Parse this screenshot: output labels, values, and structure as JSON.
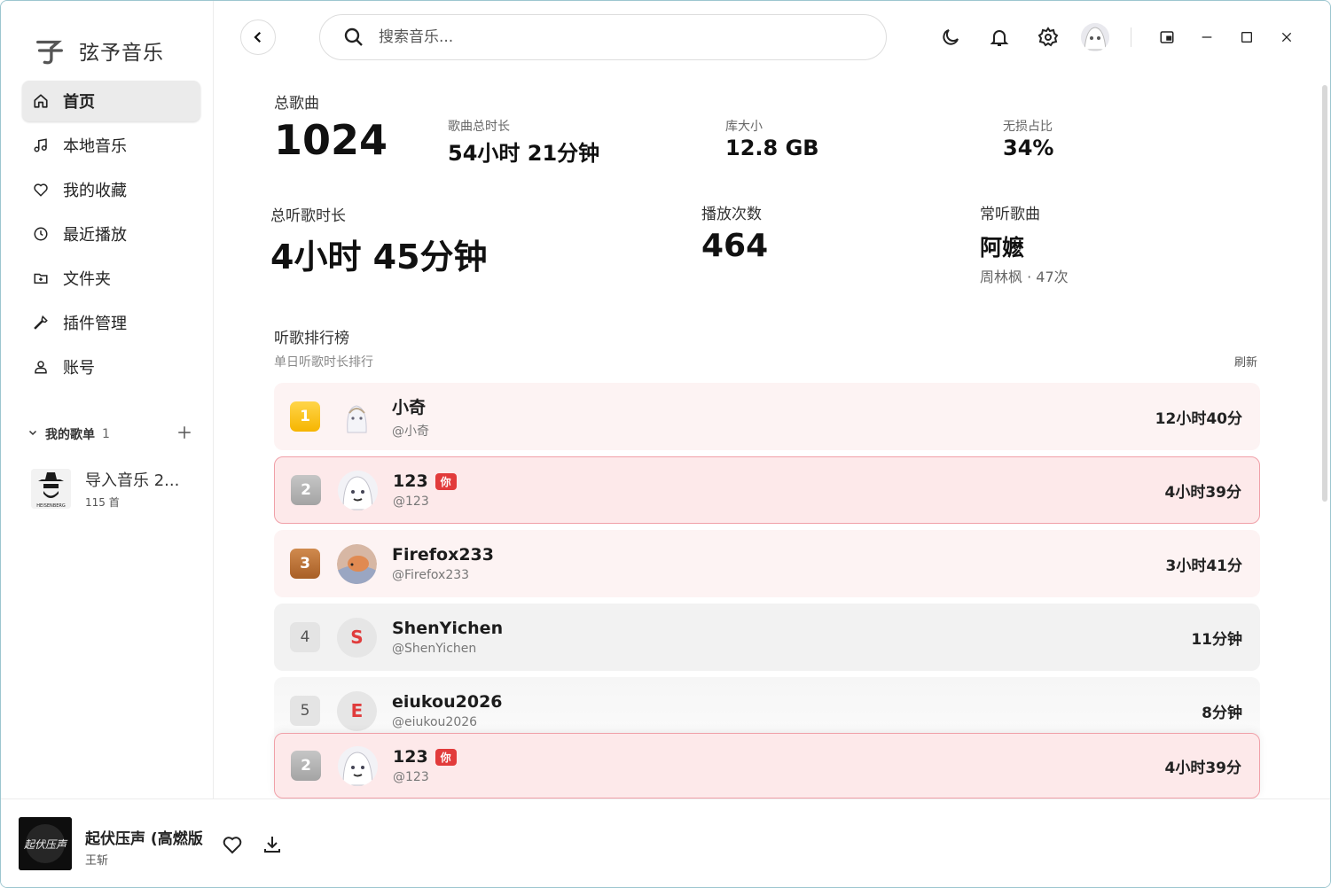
{
  "app": {
    "name": "弦予音乐"
  },
  "sidebar": {
    "items": [
      {
        "label": "首页",
        "icon": "home-icon",
        "active": true
      },
      {
        "label": "本地音乐",
        "icon": "music-note-icon"
      },
      {
        "label": "我的收藏",
        "icon": "heart-icon"
      },
      {
        "label": "最近播放",
        "icon": "clock-icon"
      },
      {
        "label": "文件夹",
        "icon": "folder-icon"
      },
      {
        "label": "插件管理",
        "icon": "wrench-icon"
      },
      {
        "label": "账号",
        "icon": "user-icon"
      }
    ],
    "playlists_header": {
      "label": "我的歌单",
      "count": "1"
    },
    "playlists": [
      {
        "title": "导入音乐 2...",
        "subtitle": "115 首",
        "cover_text": "HEISENBERG"
      }
    ]
  },
  "search": {
    "placeholder": "搜索音乐..."
  },
  "stats": {
    "total_songs_label": "总歌曲",
    "total_songs": "1024",
    "duration_label": "歌曲总时长",
    "duration": "54小时 21分钟",
    "library_size_label": "库大小",
    "library_size": "12.8 GB",
    "lossless_label": "无损占比",
    "lossless": "34%",
    "listen_time_label": "总听歌时长",
    "listen_time": "4小时 45分钟",
    "plays_label": "播放次数",
    "plays": "464",
    "top_song_label": "常听歌曲",
    "top_song": "阿嬷",
    "top_song_meta": "周林枫 · 47次"
  },
  "ranking": {
    "title": "听歌排行榜",
    "subtitle": "单日听歌时长排行",
    "refresh_label": "刷新",
    "you_tag": "你",
    "rows": [
      {
        "rank": "1",
        "name": "小奇",
        "handle": "@小奇",
        "time": "12小时40分"
      },
      {
        "rank": "2",
        "name": "123",
        "handle": "@123",
        "time": "4小时39分",
        "is_me": true
      },
      {
        "rank": "3",
        "name": "Firefox233",
        "handle": "@Firefox233",
        "time": "3小时41分"
      },
      {
        "rank": "4",
        "name": "ShenYichen",
        "handle": "@ShenYichen",
        "time": "11分钟",
        "letter": "S"
      },
      {
        "rank": "5",
        "name": "eiukou2026",
        "handle": "@eiukou2026",
        "time": "8分钟",
        "letter": "E"
      }
    ],
    "sticky": {
      "rank": "2",
      "name": "123",
      "handle": "@123",
      "time": "4小时39分"
    }
  },
  "player": {
    "title": "起伏压声 (高燃版",
    "artist": "王斩",
    "cover_text": "起伏压声"
  },
  "colors": {
    "accent_red": "#e23b3b",
    "gold": "#f6b500",
    "bronze": "#a85f26"
  }
}
